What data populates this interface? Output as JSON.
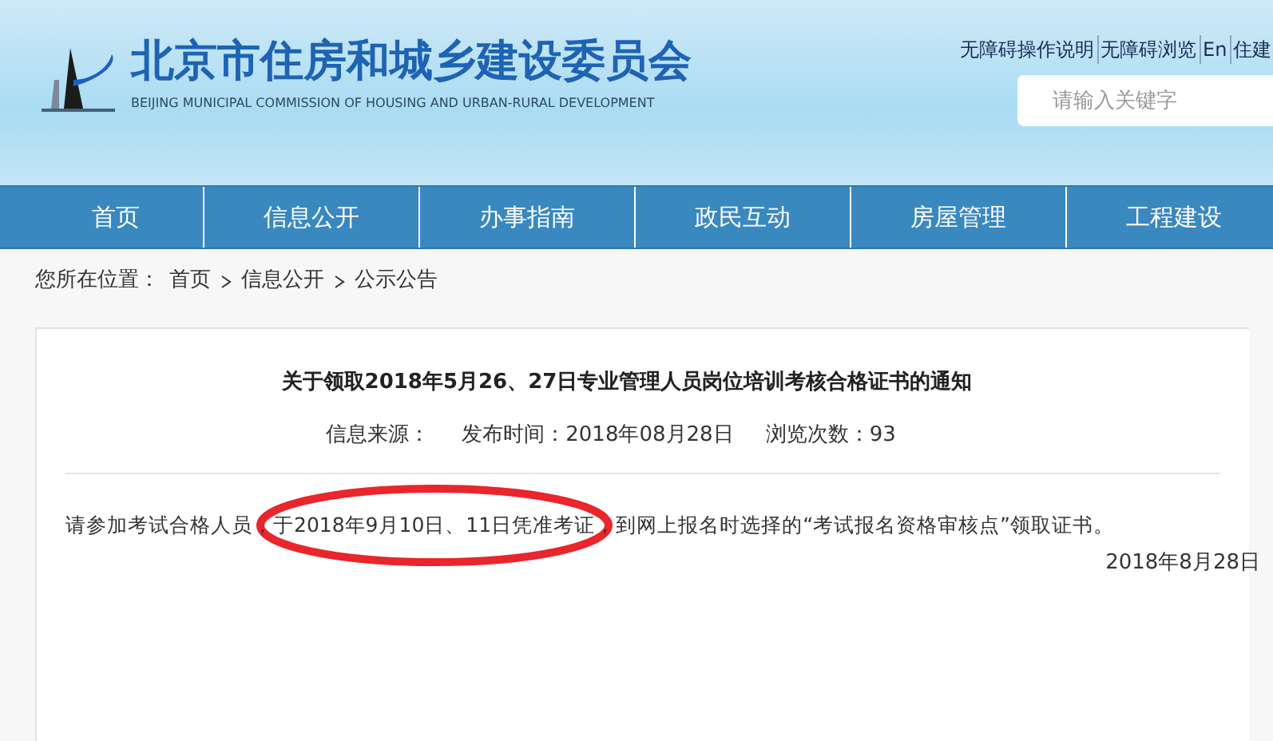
{
  "header": {
    "title": "北京市住房和城乡建设委员会",
    "subtitle": "BEIJING MUNICIPAL COMMISSION OF HOUSING AND URBAN-RURAL DEVELOPMENT",
    "top_links": [
      "无障碍操作说明",
      "无障碍浏览",
      "En",
      "住建"
    ],
    "search": {
      "placeholder": "请输入关键字"
    }
  },
  "nav": [
    {
      "label": "首页",
      "selected": false
    },
    {
      "label": "信息公开",
      "selected": false
    },
    {
      "label": "办事指南",
      "selected": false
    },
    {
      "label": "政民互动",
      "selected": false
    },
    {
      "label": "房屋管理",
      "selected": false
    },
    {
      "label": "工程建设",
      "selected": false
    }
  ],
  "breadcrumb": {
    "prefix": "您所在位置：",
    "items": [
      "首页",
      "信息公开",
      "公示公告"
    ]
  },
  "article": {
    "title": "关于领取2018年5月26、27日专业管理人员岗位培训考核合格证书的通知",
    "meta": [
      "信息来源：",
      "发布时间：2018年08月28日",
      "浏览次数：93"
    ],
    "body": "请参加考试合格人员，于2018年9月10日、11日凭准考证，到网上报名时选择的“考试报名资格审核点”领取证书。",
    "date": "2018年8月28日"
  }
}
